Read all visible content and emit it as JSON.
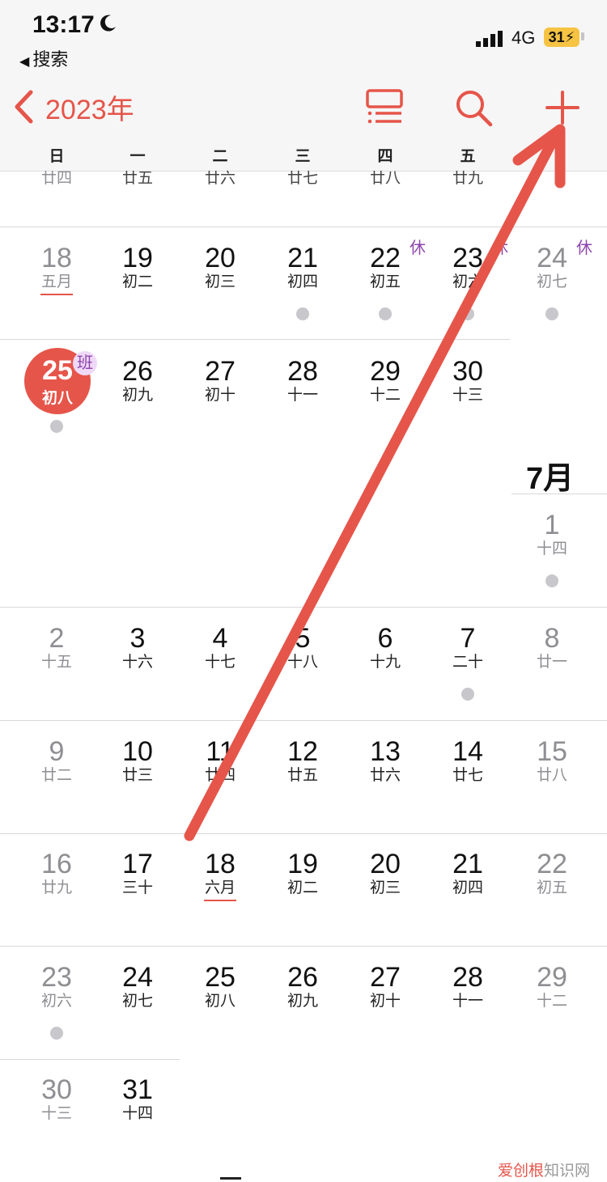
{
  "status_bar": {
    "time": "13:17",
    "back_app": "搜索",
    "network": "4G",
    "battery": "31"
  },
  "nav": {
    "year_label": "2023年"
  },
  "weekdays": [
    "日",
    "一",
    "二",
    "三",
    "四",
    "五"
  ],
  "partial_row": [
    "廿四",
    "廿五",
    "廿六",
    "廿七",
    "廿八",
    "廿九"
  ],
  "today": {
    "num": "25",
    "lunar": "初八",
    "badge": "班"
  },
  "june_week_18": [
    {
      "num": "18",
      "lunar": "五月",
      "weekend": true,
      "month_start": true
    },
    {
      "num": "19",
      "lunar": "初二"
    },
    {
      "num": "20",
      "lunar": "初三"
    },
    {
      "num": "21",
      "lunar": "初四",
      "dot": true
    },
    {
      "num": "22",
      "lunar": "初五",
      "rest": "休",
      "dot": true
    },
    {
      "num": "23",
      "lunar": "初六",
      "rest": "休",
      "dot": true
    },
    {
      "num": "24",
      "lunar": "初七",
      "rest": "休",
      "weekend": true,
      "dot": true
    }
  ],
  "june_week_25": [
    {
      "num": "26",
      "lunar": "初九"
    },
    {
      "num": "27",
      "lunar": "初十"
    },
    {
      "num": "28",
      "lunar": "十一"
    },
    {
      "num": "29",
      "lunar": "十二"
    },
    {
      "num": "30",
      "lunar": "十三"
    }
  ],
  "july_label": "7月",
  "july_1": {
    "num": "1",
    "lunar": "十四"
  },
  "july_weeks": [
    [
      {
        "num": "2",
        "lunar": "十五",
        "weekend": true
      },
      {
        "num": "3",
        "lunar": "十六"
      },
      {
        "num": "4",
        "lunar": "十七"
      },
      {
        "num": "5",
        "lunar": "十八"
      },
      {
        "num": "6",
        "lunar": "十九"
      },
      {
        "num": "7",
        "lunar": "二十",
        "dot": true
      },
      {
        "num": "8",
        "lunar": "廿一",
        "weekend": true
      }
    ],
    [
      {
        "num": "9",
        "lunar": "廿二",
        "weekend": true
      },
      {
        "num": "10",
        "lunar": "廿三"
      },
      {
        "num": "11",
        "lunar": "廿四"
      },
      {
        "num": "12",
        "lunar": "廿五"
      },
      {
        "num": "13",
        "lunar": "廿六"
      },
      {
        "num": "14",
        "lunar": "廿七"
      },
      {
        "num": "15",
        "lunar": "廿八",
        "weekend": true
      }
    ],
    [
      {
        "num": "16",
        "lunar": "廿九",
        "weekend": true
      },
      {
        "num": "17",
        "lunar": "三十"
      },
      {
        "num": "18",
        "lunar": "六月",
        "month_start": true
      },
      {
        "num": "19",
        "lunar": "初二"
      },
      {
        "num": "20",
        "lunar": "初三"
      },
      {
        "num": "21",
        "lunar": "初四"
      },
      {
        "num": "22",
        "lunar": "初五",
        "weekend": true
      }
    ],
    [
      {
        "num": "23",
        "lunar": "初六",
        "weekend": true,
        "dot": true
      },
      {
        "num": "24",
        "lunar": "初七"
      },
      {
        "num": "25",
        "lunar": "初八"
      },
      {
        "num": "26",
        "lunar": "初九"
      },
      {
        "num": "27",
        "lunar": "初十"
      },
      {
        "num": "28",
        "lunar": "十一"
      },
      {
        "num": "29",
        "lunar": "十二",
        "weekend": true
      }
    ],
    [
      {
        "num": "30",
        "lunar": "十三",
        "weekend": true
      },
      {
        "num": "31",
        "lunar": "十四"
      }
    ]
  ],
  "watermark": {
    "brand": "爱创根",
    "suffix": "知识网"
  },
  "colors": {
    "accent": "#e6554a",
    "holiday_badge": "#8e44ad",
    "event_dot": "#c7c7cc"
  }
}
